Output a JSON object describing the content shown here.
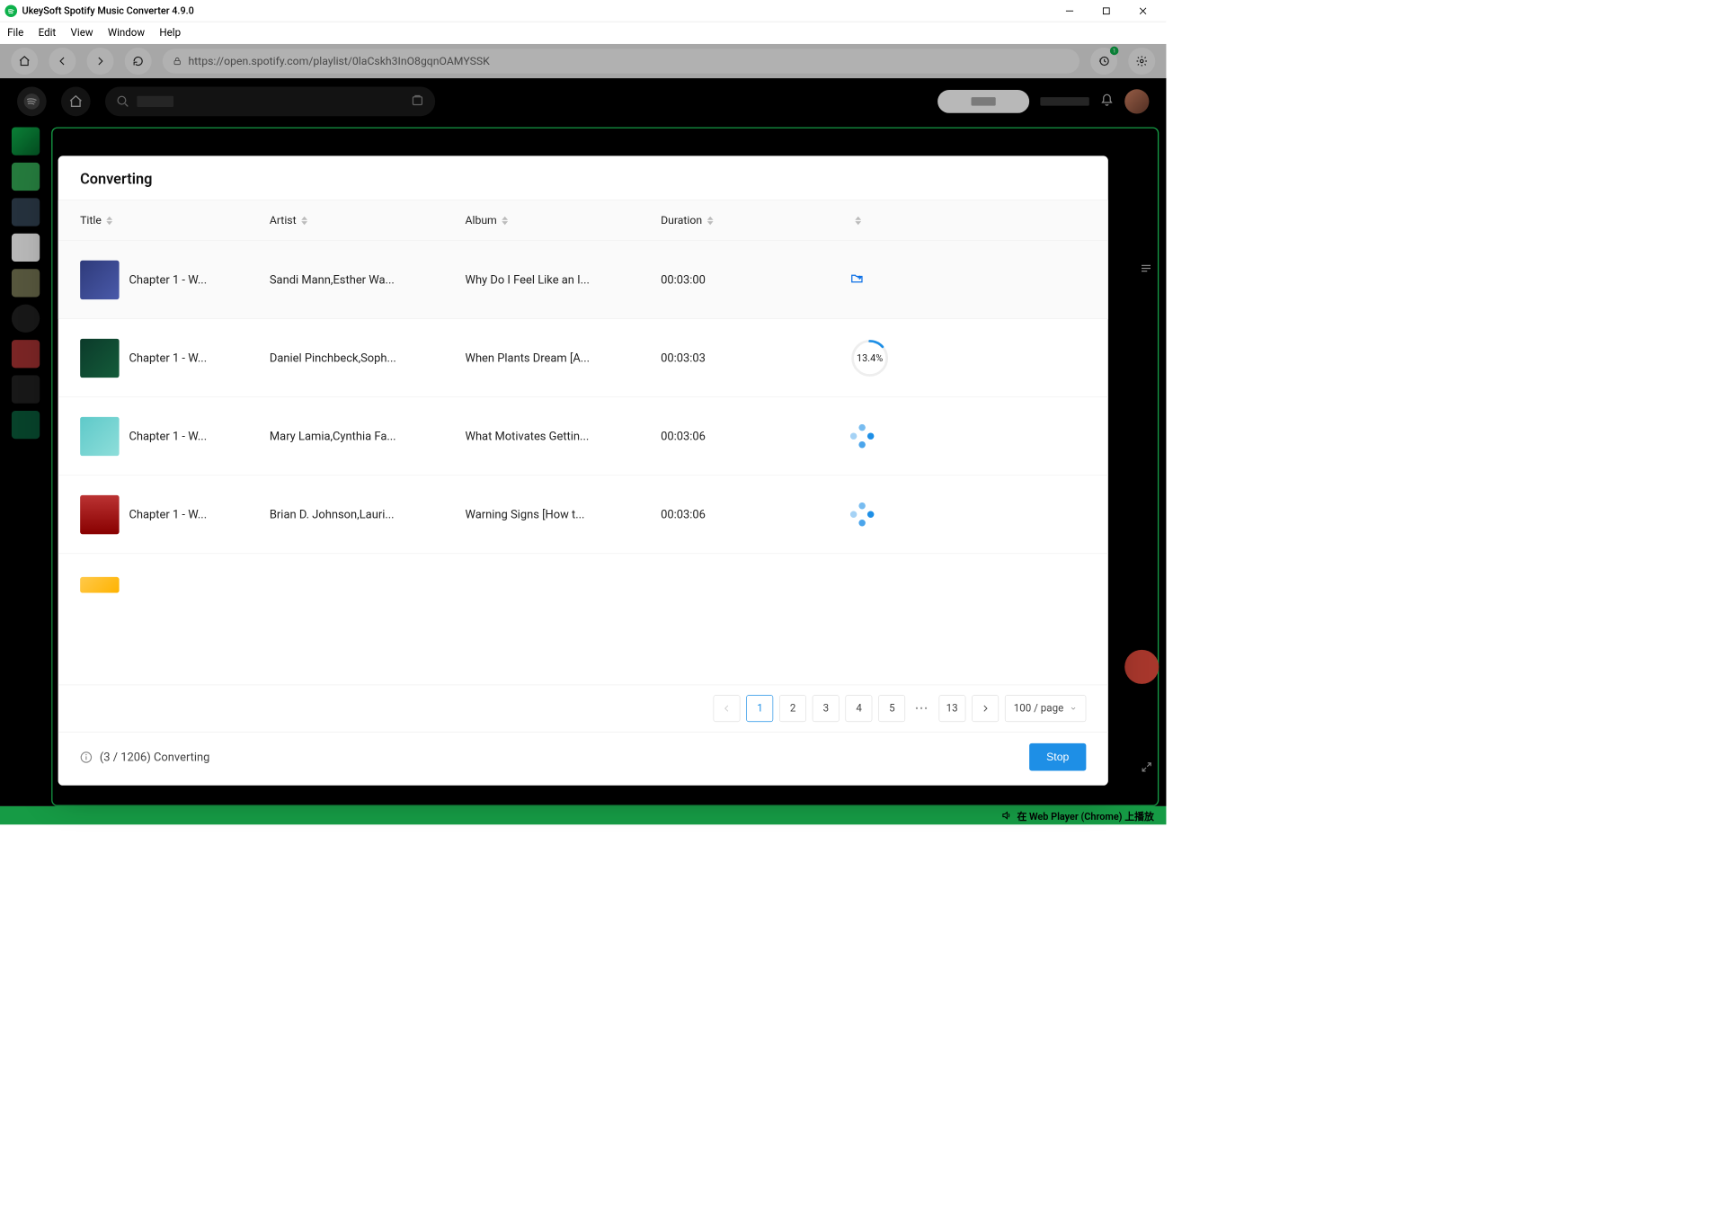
{
  "app": {
    "title": "UkeySoft Spotify Music Converter 4.9.0"
  },
  "menu": {
    "file": "File",
    "edit": "Edit",
    "view": "View",
    "window": "Window",
    "help": "Help"
  },
  "browser": {
    "url": "https://open.spotify.com/playlist/0laCskh3InO8gqnOAMYSSK",
    "history_badge": "1"
  },
  "bottom_bar": {
    "text": "在 Web Player (Chrome) 上播放"
  },
  "modal": {
    "title": "Converting",
    "columns": {
      "title": "Title",
      "artist": "Artist",
      "album": "Album",
      "duration": "Duration"
    },
    "rows": [
      {
        "title": "Chapter 1 - W...",
        "artist": "Sandi Mann,Esther Wa...",
        "album": "Why Do I Feel Like an I...",
        "duration": "00:03:00",
        "status": "done"
      },
      {
        "title": "Chapter 1 - W...",
        "artist": "Daniel Pinchbeck,Soph...",
        "album": "When Plants Dream [A...",
        "duration": "00:03:03",
        "status": "progress",
        "progressText": "13.4%",
        "progressFrac": 0.134
      },
      {
        "title": "Chapter 1 - W...",
        "artist": "Mary Lamia,Cynthia Fa...",
        "album": "What Motivates Gettin...",
        "duration": "00:03:06",
        "status": "waiting"
      },
      {
        "title": "Chapter 1 - W...",
        "artist": "Brian D. Johnson,Lauri...",
        "album": "Warning Signs [How t...",
        "duration": "00:03:06",
        "status": "waiting"
      }
    ],
    "pagination": {
      "pages": [
        "1",
        "2",
        "3",
        "4",
        "5"
      ],
      "last": "13",
      "pageSize": "100 / page"
    },
    "footer": {
      "status": "(3 / 1206) Converting",
      "stop": "Stop"
    }
  }
}
